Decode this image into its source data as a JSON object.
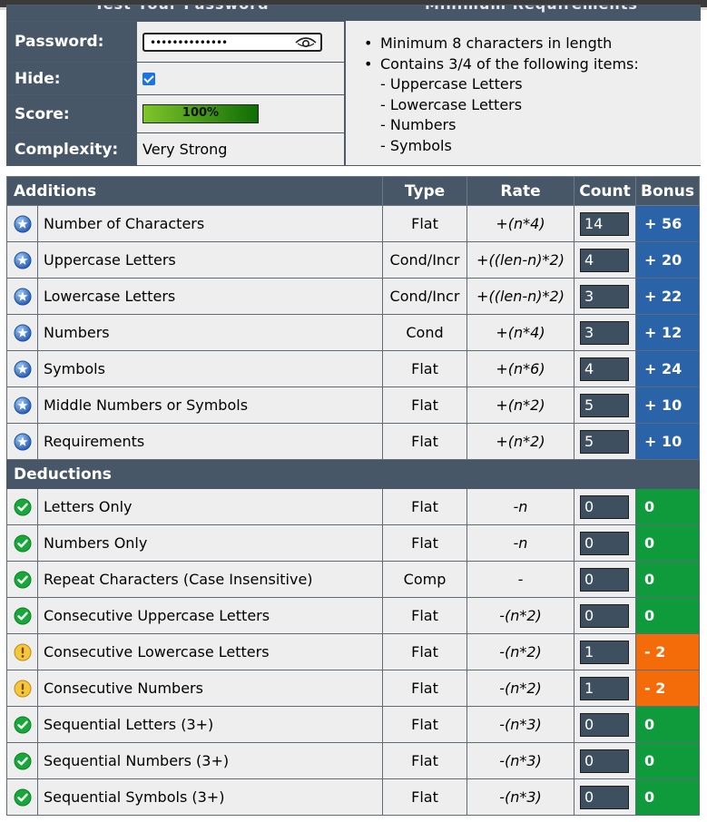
{
  "header": {
    "left_title": "Test Your Password",
    "right_title": "Minimum Requirements"
  },
  "form": {
    "password_label": "Password:",
    "password_value": "••••••••••••••",
    "hide_label": "Hide:",
    "hide_checked": true,
    "score_label": "Score:",
    "score_value": "100%",
    "score_fraction": 1.0,
    "complexity_label": "Complexity:",
    "complexity_value": "Very Strong"
  },
  "requirements": {
    "items": [
      "Minimum 8 characters in length",
      "Contains 3/4 of the following items:"
    ],
    "sub_items": [
      "- Uppercase Letters",
      "- Lowercase Letters",
      "- Numbers",
      "- Symbols"
    ]
  },
  "table": {
    "headers": {
      "additions": "Additions",
      "type": "Type",
      "rate": "Rate",
      "count": "Count",
      "bonus": "Bonus"
    },
    "deductions_label": "Deductions",
    "additions": [
      {
        "name": "Number of Characters",
        "type": "Flat",
        "rate": "+(n*4)",
        "count": "14",
        "bonus": "+ 56"
      },
      {
        "name": "Uppercase Letters",
        "type": "Cond/Incr",
        "rate": "+((len-n)*2)",
        "count": "4",
        "bonus": "+ 20"
      },
      {
        "name": "Lowercase Letters",
        "type": "Cond/Incr",
        "rate": "+((len-n)*2)",
        "count": "3",
        "bonus": "+ 22"
      },
      {
        "name": "Numbers",
        "type": "Cond",
        "rate": "+(n*4)",
        "count": "3",
        "bonus": "+ 12"
      },
      {
        "name": "Symbols",
        "type": "Flat",
        "rate": "+(n*6)",
        "count": "4",
        "bonus": "+ 24"
      },
      {
        "name": "Middle Numbers or Symbols",
        "type": "Flat",
        "rate": "+(n*2)",
        "count": "5",
        "bonus": "+ 10"
      },
      {
        "name": "Requirements",
        "type": "Flat",
        "rate": "+(n*2)",
        "count": "5",
        "bonus": "+ 10"
      }
    ],
    "deductions": [
      {
        "name": "Letters Only",
        "type": "Flat",
        "rate": "-n",
        "count": "0",
        "bonus": "0",
        "status": "pass"
      },
      {
        "name": "Numbers Only",
        "type": "Flat",
        "rate": "-n",
        "count": "0",
        "bonus": "0",
        "status": "pass"
      },
      {
        "name": "Repeat Characters (Case Insensitive)",
        "type": "Comp",
        "rate": "-",
        "count": "0",
        "bonus": "0",
        "status": "pass"
      },
      {
        "name": "Consecutive Uppercase Letters",
        "type": "Flat",
        "rate": "-(n*2)",
        "count": "0",
        "bonus": "0",
        "status": "pass"
      },
      {
        "name": "Consecutive Lowercase Letters",
        "type": "Flat",
        "rate": "-(n*2)",
        "count": "1",
        "bonus": "- 2",
        "status": "warn"
      },
      {
        "name": "Consecutive Numbers",
        "type": "Flat",
        "rate": "-(n*2)",
        "count": "1",
        "bonus": "- 2",
        "status": "warn"
      },
      {
        "name": "Sequential Letters (3+)",
        "type": "Flat",
        "rate": "-(n*3)",
        "count": "0",
        "bonus": "0",
        "status": "pass"
      },
      {
        "name": "Sequential Numbers (3+)",
        "type": "Flat",
        "rate": "-(n*3)",
        "count": "0",
        "bonus": "0",
        "status": "pass"
      },
      {
        "name": "Sequential Symbols (3+)",
        "type": "Flat",
        "rate": "-(n*3)",
        "count": "0",
        "bonus": "0",
        "status": "pass"
      }
    ]
  },
  "icons": {
    "addition": "star-icon",
    "pass": "check-circle-icon",
    "warn": "exclamation-circle-icon",
    "password_toggle": "eye-icon"
  },
  "colors": {
    "header_bg": "#485767",
    "bonus_blue": "#2b63a8",
    "bonus_green": "#0f9a3b",
    "bonus_orange": "#f46c0a"
  }
}
